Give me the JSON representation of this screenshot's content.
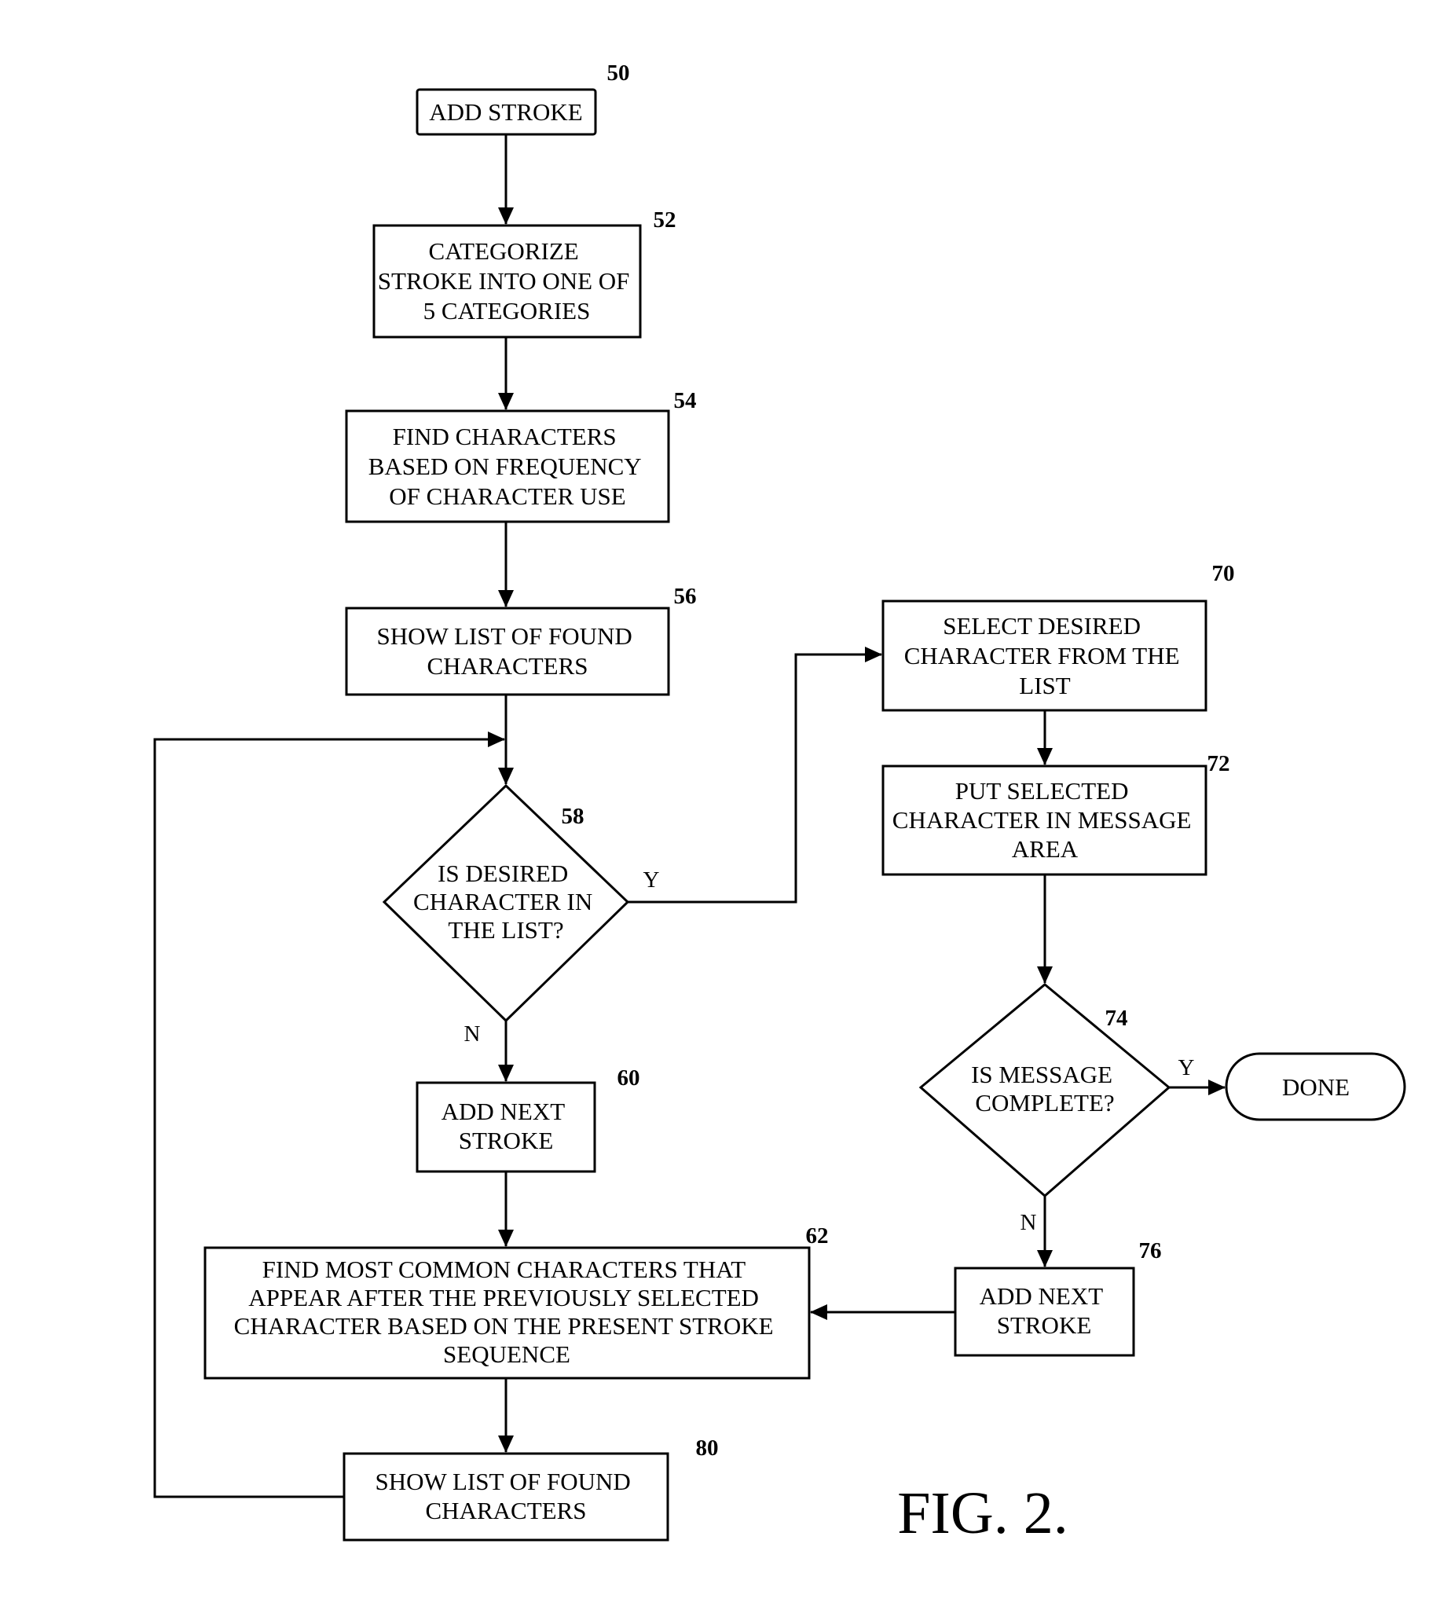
{
  "figure_label": "FIG. 2.",
  "nodes": {
    "n50": {
      "ref": "50",
      "type": "process",
      "lines": [
        "ADD STROKE"
      ]
    },
    "n52": {
      "ref": "52",
      "type": "process",
      "lines": [
        "CATEGORIZE",
        "STROKE INTO ONE OF",
        "5 CATEGORIES"
      ]
    },
    "n54": {
      "ref": "54",
      "type": "process",
      "lines": [
        "FIND CHARACTERS",
        "BASED ON FREQUENCY",
        "OF CHARACTER USE"
      ]
    },
    "n56": {
      "ref": "56",
      "type": "process",
      "lines": [
        "SHOW LIST OF FOUND",
        "CHARACTERS"
      ]
    },
    "n58": {
      "ref": "58",
      "type": "decision",
      "lines": [
        "IS DESIRED",
        "CHARACTER IN",
        "THE LIST?"
      ]
    },
    "n60": {
      "ref": "60",
      "type": "process",
      "lines": [
        "ADD NEXT",
        "STROKE"
      ]
    },
    "n62": {
      "ref": "62",
      "type": "process",
      "lines": [
        "FIND MOST COMMON CHARACTERS THAT",
        "APPEAR AFTER THE PREVIOUSLY SELECTED",
        "CHARACTER BASED ON THE PRESENT STROKE",
        "SEQUENCE"
      ]
    },
    "n80": {
      "ref": "80",
      "type": "process",
      "lines": [
        "SHOW LIST OF FOUND",
        "CHARACTERS"
      ]
    },
    "n70": {
      "ref": "70",
      "type": "process",
      "lines": [
        "SELECT DESIRED",
        "CHARACTER FROM THE",
        "LIST"
      ]
    },
    "n72": {
      "ref": "72",
      "type": "process",
      "lines": [
        "PUT SELECTED",
        "CHARACTER IN MESSAGE",
        "AREA"
      ]
    },
    "n74": {
      "ref": "74",
      "type": "decision",
      "lines": [
        "IS MESSAGE",
        "COMPLETE?"
      ]
    },
    "n76": {
      "ref": "76",
      "type": "process",
      "lines": [
        "ADD NEXT",
        "STROKE"
      ]
    },
    "done": {
      "ref": "",
      "type": "terminator",
      "lines": [
        "DONE"
      ]
    }
  },
  "edges": [
    {
      "from": "n50",
      "to": "n52",
      "label": ""
    },
    {
      "from": "n52",
      "to": "n54",
      "label": ""
    },
    {
      "from": "n54",
      "to": "n56",
      "label": ""
    },
    {
      "from": "n56",
      "to": "n58",
      "label": ""
    },
    {
      "from": "n58",
      "to": "n70",
      "label": "Y"
    },
    {
      "from": "n58",
      "to": "n60",
      "label": "N"
    },
    {
      "from": "n60",
      "to": "n62",
      "label": ""
    },
    {
      "from": "n62",
      "to": "n80",
      "label": ""
    },
    {
      "from": "n80",
      "to": "n58",
      "label": ""
    },
    {
      "from": "n70",
      "to": "n72",
      "label": ""
    },
    {
      "from": "n72",
      "to": "n74",
      "label": ""
    },
    {
      "from": "n74",
      "to": "done",
      "label": "Y"
    },
    {
      "from": "n74",
      "to": "n76",
      "label": "N"
    },
    {
      "from": "n76",
      "to": "n62",
      "label": ""
    }
  ]
}
